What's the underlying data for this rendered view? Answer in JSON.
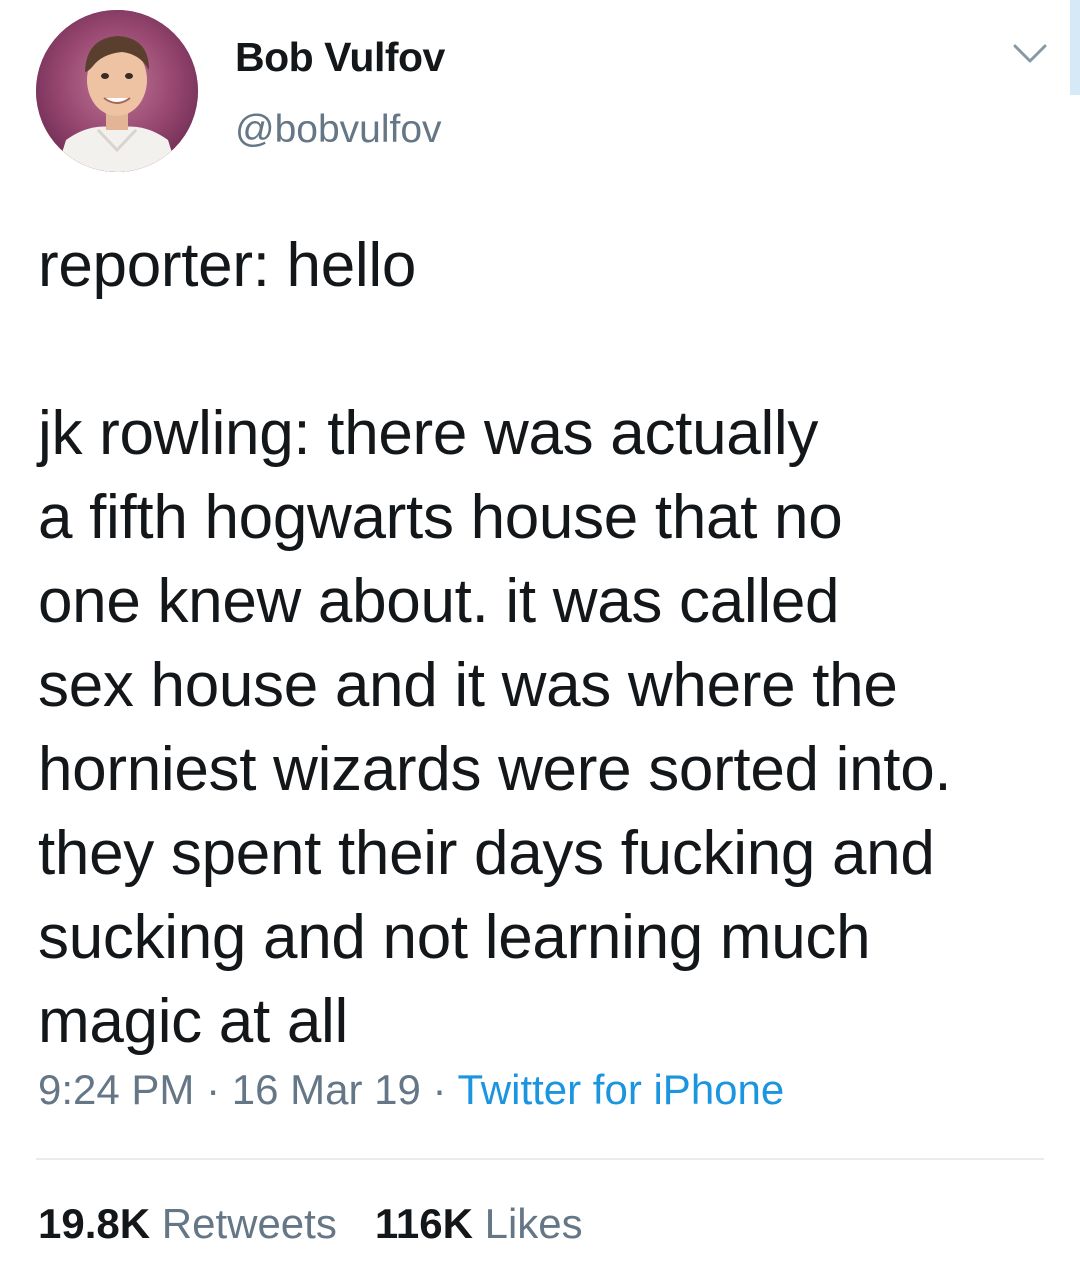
{
  "tweet": {
    "author": {
      "display_name": "Bob Vulfov",
      "handle": "@bobvulfov"
    },
    "text_lines": [
      "reporter: hello",
      "",
      "jk rowling: there was actually",
      "a fifth hogwarts house that no",
      "one knew about. it was called",
      "sex house and it was where the",
      "horniest wizards were sorted into.",
      "they spent their days fucking and",
      "sucking and not learning much",
      "magic at all"
    ],
    "time": "9:24 PM",
    "separator": " · ",
    "date": "16 Mar 19",
    "source": "Twitter for iPhone",
    "retweets_count": "19.8K",
    "retweets_label": "Retweets",
    "likes_count": "116K",
    "likes_label": "Likes"
  },
  "icons": {
    "menu": "chevron-down-icon"
  },
  "colors": {
    "text": "#14171a",
    "secondary": "#657786",
    "link": "#1b95e0",
    "divider": "#e6ecf0"
  }
}
